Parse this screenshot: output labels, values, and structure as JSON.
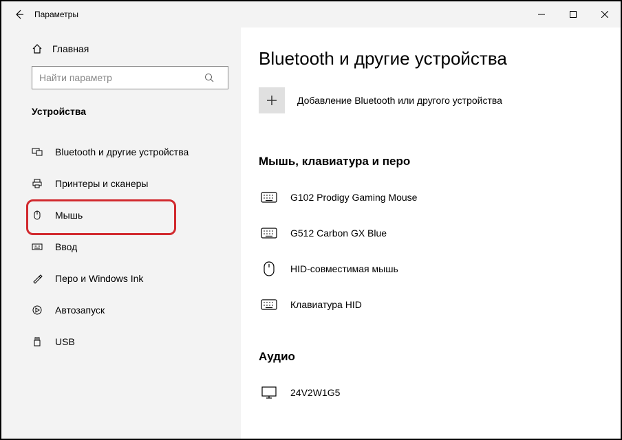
{
  "titlebar": {
    "app_title": "Параметры"
  },
  "sidebar": {
    "home_label": "Главная",
    "search_placeholder": "Найти параметр",
    "section_label": "Устройства",
    "items": [
      {
        "label": "Bluetooth и другие устройства"
      },
      {
        "label": "Принтеры и сканеры"
      },
      {
        "label": "Мышь"
      },
      {
        "label": "Ввод"
      },
      {
        "label": "Перо и Windows Ink"
      },
      {
        "label": "Автозапуск"
      },
      {
        "label": "USB"
      }
    ]
  },
  "main": {
    "page_title": "Bluetooth и другие устройства",
    "add_device_label": "Добавление Bluetooth или другого устройства",
    "group1_heading": "Мышь, клавиатура и перо",
    "devices1": [
      {
        "label": "G102 Prodigy Gaming Mouse"
      },
      {
        "label": "G512 Carbon GX Blue"
      },
      {
        "label": "HID-совместимая мышь"
      },
      {
        "label": "Клавиатура HID"
      }
    ],
    "group2_heading": "Аудио",
    "devices2": [
      {
        "label": "24V2W1G5"
      }
    ]
  }
}
